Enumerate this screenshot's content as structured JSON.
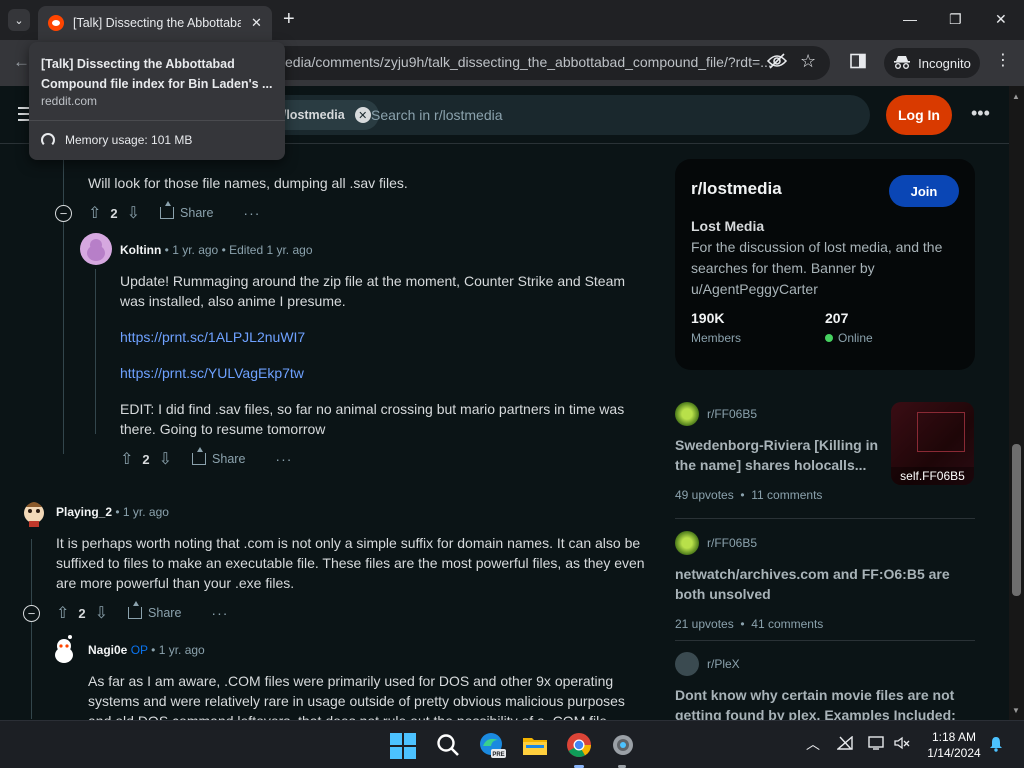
{
  "browser": {
    "tab_title": "[Talk] Dissecting the Abbottabad Compound file index for Bin Laden's ...",
    "tab_close": "✕",
    "new_tab": "+",
    "url": "edia/comments/zyju9h/talk_dissecting_the_abbottabad_compound_file/?rdt=...",
    "incognito_label": "Incognito",
    "hover_card": {
      "title": "[Talk] Dissecting the Abbottabad Compound file index for Bin Laden's ...",
      "domain": "reddit.com",
      "memory": "Memory usage: 101 MB"
    }
  },
  "header": {
    "subreddit_chip": "r/lostmedia",
    "search_placeholder": "Search in r/lostmedia",
    "login_label": "Log In"
  },
  "comments": [
    {
      "text": "Will look for those file names, dumping all .sav files.",
      "votes": "2",
      "share": "Share"
    },
    {
      "author": "Koltinn",
      "meta": " • 1 yr. ago • Edited 1 yr. ago",
      "paragraphs": [
        "Update! Rummaging around the zip file at the moment, Counter Strike and Steam was installed, also anime I presume.",
        "https://prnt.sc/1ALPJL2nuWI7",
        "https://prnt.sc/YULVagEkp7tw",
        "EDIT: I did find .sav files, so far no animal crossing but mario partners in time was there. Going to resume tomorrow"
      ],
      "votes": "2",
      "share": "Share"
    },
    {
      "author": "Playing_2",
      "meta": " • 1 yr. ago",
      "text": "It is perhaps worth noting that .com is not only a simple suffix for domain names. It can also be suffixed to files to make an executable file. These files are the most powerful files, as they even are more powerful than your .exe files.",
      "votes": "2",
      "share": "Share"
    },
    {
      "author": "Nagi0e",
      "op": "OP",
      "meta": " • 1 yr. ago",
      "text": "As far as I am aware, .COM files were primarily used for DOS and other 9x operating systems and were relatively rare in usage outside of pretty obvious malicious purposes and old DOS command leftovers, that does not rule out the possibility of a .COM file"
    }
  ],
  "sidebar": {
    "name": "r/lostmedia",
    "join_label": "Join",
    "title": "Lost Media",
    "description": "For the discussion of lost media, and the searches for them. Banner by u/AgentPeggyCarter",
    "members_value": "190K",
    "members_label": "Members",
    "online_value": "207",
    "online_label": "Online",
    "related": [
      {
        "sub": "r/FF06B5",
        "title": "Swedenborg-Riviera [Killing in the name] shares holocalls...",
        "upvotes": "49 upvotes",
        "comments": "11 comments",
        "thumb_label": "self.FF06B5"
      },
      {
        "sub": "r/FF06B5",
        "title": "netwatch/archives.com and FF:O6:B5 are both unsolved",
        "upvotes": "21 upvotes",
        "comments": "41 comments"
      },
      {
        "sub": "r/PleX",
        "title": "Dont know why certain movie files are not getting found by plex. Examples Included:"
      }
    ]
  },
  "taskbar": {
    "time": "1:18 AM",
    "date": "1/14/2024"
  }
}
